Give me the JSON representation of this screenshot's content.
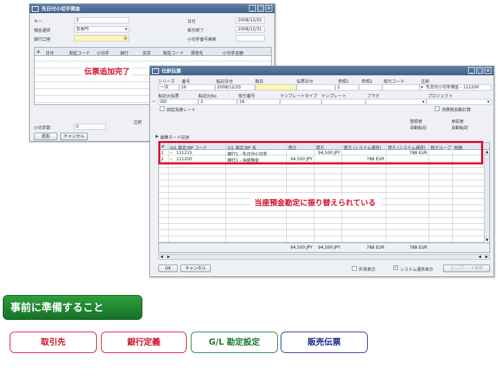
{
  "win1": {
    "title": "先日付小切手預金",
    "fields": {
      "key_label": "キー",
      "key_value": "3",
      "currency_label": "預金通貨",
      "currency_value": "日本円",
      "bank_label": "銀行口座",
      "date_label": "日付",
      "date_value": "2008/12/25",
      "display_end_label": "表示終了",
      "display_end_value": "2008/12/31",
      "check_range_label": "小切手番号検索"
    },
    "grid_headers": [
      "#",
      "日付",
      "勘定コード",
      "小切手",
      "銀行",
      "支店",
      "勘定コード",
      "得意先",
      "小切手金額"
    ],
    "remarks_label": "注釈",
    "check_count_label": "小切手数",
    "check_count_value": "0",
    "add_button": "追加",
    "cancel_button": "キャンセル",
    "callout": "伝票追加完了"
  },
  "win2": {
    "title": "仕訳伝票",
    "header_labels": [
      "シリーズ",
      "番号",
      "転記日付",
      "期日",
      "伝票日付",
      "参照1",
      "参照2",
      "取引コード",
      "注釈"
    ],
    "header_values": {
      "series": "一次",
      "number": "16",
      "posting_date": "2008/12/25",
      "ref1": "2",
      "remarks": "先日付小切手預金 - 111200"
    },
    "row2_labels": [
      "転記元伝票",
      "転記元No",
      "取引番号",
      "テンプレートタイプ",
      "テンプレート",
      "フラグ",
      "プロジェクト"
    ],
    "row2_values": {
      "source_doc": "DD",
      "source_no": "2",
      "trans_no": "16"
    },
    "fixed_rate_label": "固定為替レート",
    "auto_tax_label": "消費税自動計算",
    "registrant_label": "登録者",
    "registrant_value": "自動転記",
    "approver_label": "承認者",
    "approver_value": "自動転記",
    "edit_mode_label": "編集モード記述",
    "table_headers": [
      "#",
      "G/L 勘定/BP コード",
      "G/L 勘定/BP 名",
      "借方",
      "貸方",
      "借方 (システム通貨)",
      "貸方 (システム通貨)",
      "税グループ",
      "税額"
    ],
    "rows": [
      {
        "no": "1",
        "code": "111215",
        "name": "銀行1 - 先日付小切手",
        "debit": "",
        "credit": "94,500 JPY",
        "debit_sc": "",
        "credit_sc": "788 EUR"
      },
      {
        "no": "2",
        "code": "111200",
        "name": "銀行1 - 当座預金",
        "debit": "94,500 JPY",
        "credit": "",
        "debit_sc": "788 EUR",
        "credit_sc": ""
      }
    ],
    "totals": {
      "debit": "94,500 JPY",
      "credit": "94,500 JPY",
      "debit_sc": "788 EUR",
      "credit_sc": "788 EUR"
    },
    "callout": "当座預金勘定に振り替えられている",
    "ok_button": "OK",
    "cancel_button": "キャンセル",
    "foreign_display_label": "外貨表示",
    "system_currency_label": "システム通貨表示",
    "template_button": "テンプレート配布"
  },
  "section_title": "事前に準備すること",
  "nav": [
    {
      "label": "取引先",
      "color": "#d0102a"
    },
    {
      "label": "銀行定義",
      "color": "#d0102a"
    },
    {
      "label": "G/L 勘定設定",
      "color": "#1e7a2e"
    },
    {
      "label": "販売伝票",
      "color": "#1a2a8a"
    }
  ]
}
